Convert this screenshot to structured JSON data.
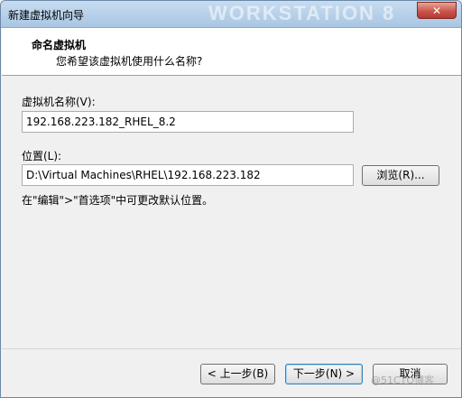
{
  "window": {
    "title": "新建虚拟机向导",
    "watermark": "WORKSTATION 8",
    "close_label": "✕"
  },
  "header": {
    "title": "命名虚拟机",
    "subtitle": "您希望该虚拟机使用什么名称?"
  },
  "vm_name": {
    "label": "虚拟机名称(V):",
    "value": "192.168.223.182_RHEL_8.2"
  },
  "location": {
    "label": "位置(L):",
    "value": "D:\\Virtual Machines\\RHEL\\192.168.223.182",
    "browse_label": "浏览(R)...",
    "hint": "在\"编辑\">\"首选项\"中可更改默认位置。"
  },
  "buttons": {
    "back": "< 上一步(B)",
    "next": "下一步(N) >",
    "cancel": "取消"
  },
  "footer_watermark": "@51CTO博客"
}
